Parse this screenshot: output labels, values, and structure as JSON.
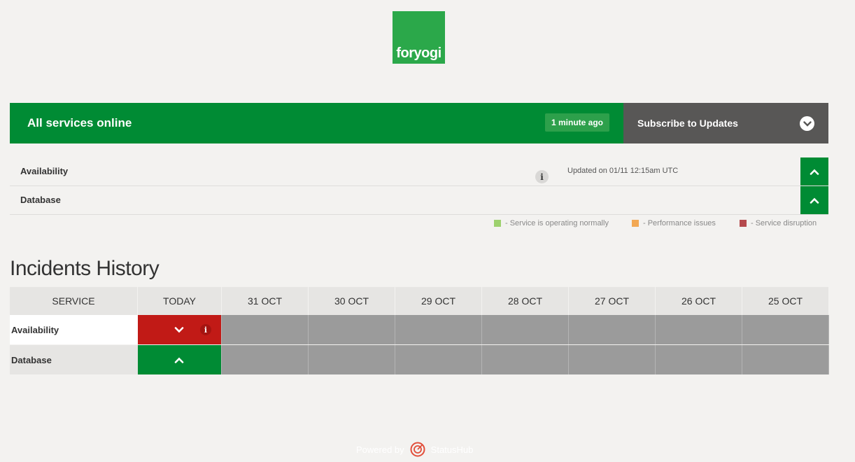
{
  "logo": {
    "text": "foryogi",
    "color": "#2ba84a"
  },
  "status": {
    "text": "All services online",
    "updated_ago": "1 minute ago",
    "color": "#008b34"
  },
  "subscribe": {
    "label": "Subscribe to Updates",
    "icon": "chevron-down-circle-icon"
  },
  "services": [
    {
      "name": "Availability",
      "updated": "Updated on 01/11 12:15am UTC",
      "info": "i"
    },
    {
      "name": "Database"
    }
  ],
  "legend": [
    {
      "label": "- Service is operating normally",
      "color": "#9dd16e"
    },
    {
      "label": "- Performance issues",
      "color": "#f2a853"
    },
    {
      "label": "- Service disruption",
      "color": "#b54a4d"
    }
  ],
  "incidents": {
    "title": "Incidents History",
    "headers": [
      "SERVICE",
      "TODAY",
      "31 OCT",
      "30 OCT",
      "29 OCT",
      "28 OCT",
      "27 OCT",
      "26 OCT",
      "25 OCT"
    ],
    "rows": [
      {
        "service": "Availability",
        "today_status": "disruption",
        "info": "i"
      },
      {
        "service": "Database",
        "today_status": "normal"
      }
    ]
  },
  "footer": {
    "powered_by": "Powered by",
    "brand": "StatusHub"
  }
}
